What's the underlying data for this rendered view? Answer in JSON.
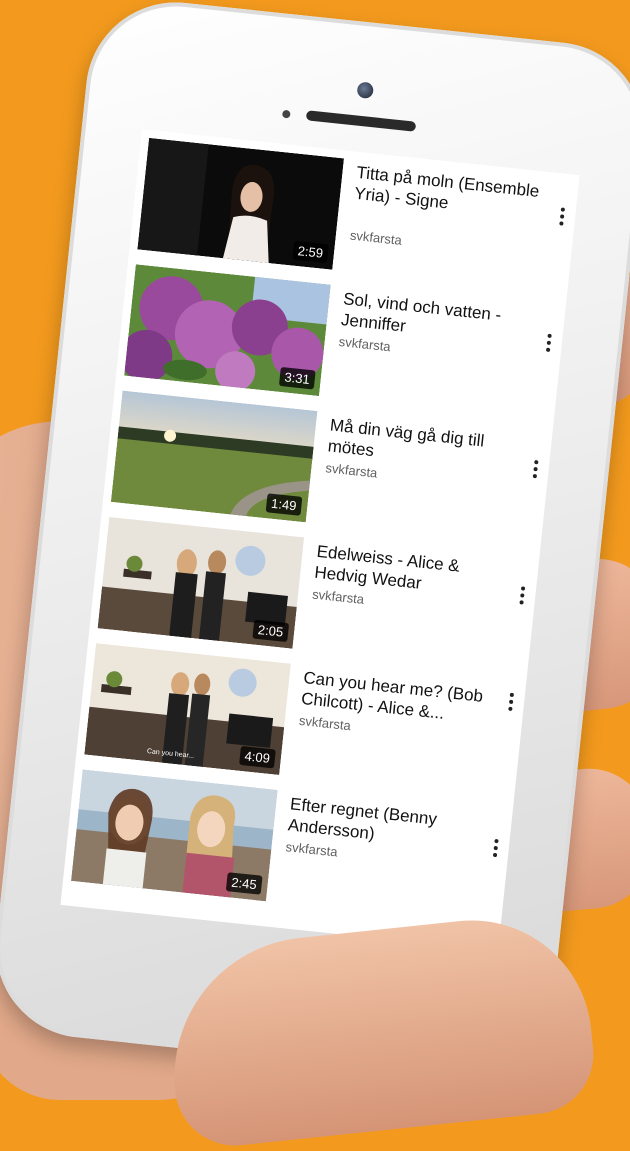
{
  "videos": [
    {
      "title": "Titta på moln (Ensemble Yria) - Signe",
      "channel": "svkfarsta",
      "duration": "2:59",
      "thumb_icon": "girl-singing-dark-stage"
    },
    {
      "title": "Sol, vind och vatten - Jenniffer",
      "channel": "svkfarsta",
      "duration": "3:31",
      "thumb_icon": "lilac-flowers"
    },
    {
      "title": "Må din väg gå dig till mötes",
      "channel": "svkfarsta",
      "duration": "1:49",
      "thumb_icon": "sunset-field-road"
    },
    {
      "title": "Edelweiss - Alice & Hedvig Wedar",
      "channel": "svkfarsta",
      "duration": "2:05",
      "thumb_icon": "girls-singing-church"
    },
    {
      "title": "Can you hear me? (Bob Chilcott) - Alice &...",
      "channel": "svkfarsta",
      "duration": "4:09",
      "thumb_icon": "girls-singing-church-wide",
      "thumb_caption": "Can you hear..."
    },
    {
      "title": "Efter regnet (Benny Andersson)",
      "channel": "svkfarsta",
      "duration": "2:45",
      "thumb_icon": "two-girls-outdoors"
    }
  ],
  "colors": {
    "background": "#F39A1E",
    "text": "#111111",
    "secondary_text": "#606060"
  }
}
